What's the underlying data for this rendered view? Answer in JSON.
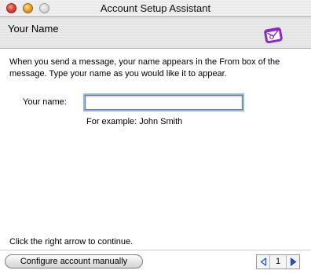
{
  "window": {
    "title": "Account Setup Assistant"
  },
  "header": {
    "title": "Your Name",
    "logo_icon": "entourage-envelope-icon"
  },
  "intro": {
    "text": "When you send a message, your name appears in the From box of the message. Type your name as you would like it to appear."
  },
  "form": {
    "name_label": "Your name:",
    "name_value": "",
    "example": "For example: John Smith"
  },
  "footer": {
    "instruction": "Click the right arrow to continue.",
    "configure_button": "Configure account manually",
    "page_number": "1"
  },
  "colors": {
    "focus_ring": "#8fb4e6",
    "nav_arrow": "#2a52c8",
    "logo_purple": "#8a2ac8"
  }
}
